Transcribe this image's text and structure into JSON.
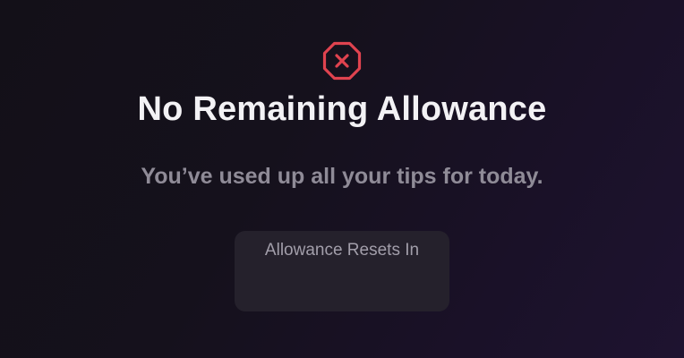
{
  "icon": "octagon-x-icon",
  "colors": {
    "accent_error": "#e0434f"
  },
  "title": "No Remaining Allowance",
  "subtitle": "You’ve used up all your tips for today.",
  "reset_card": {
    "label": "Allowance Resets In",
    "value": ""
  }
}
